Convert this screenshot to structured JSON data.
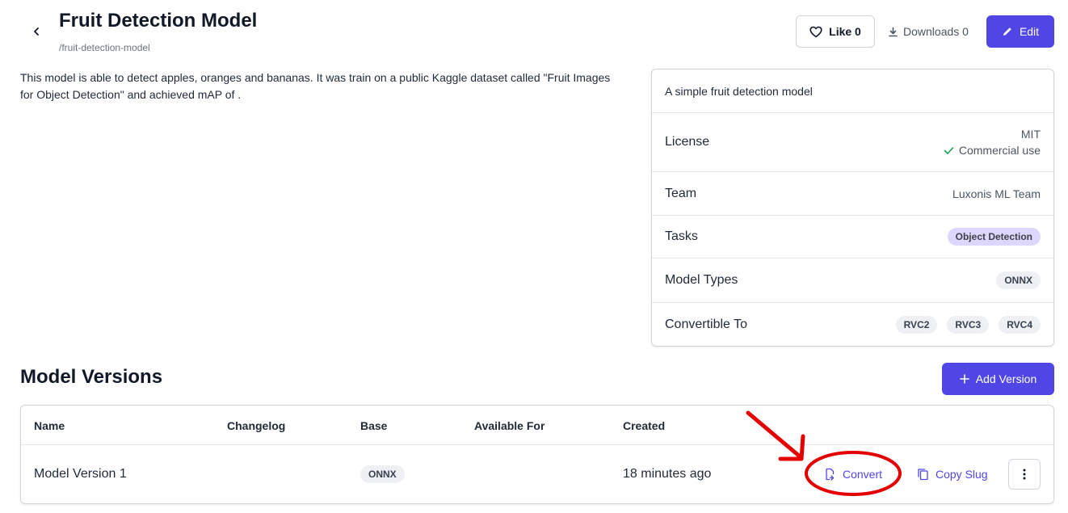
{
  "header": {
    "title": "Fruit Detection Model",
    "slug": "/fruit-detection-model",
    "like_label": "Like 0",
    "downloads_label": "Downloads 0",
    "edit_label": "Edit"
  },
  "description": "This model is able to detect apples, oranges and bananas. It was train on a public Kaggle dataset called \"Fruit Images for Object Detection\" and achieved mAP of .",
  "info": {
    "summary": "A simple fruit detection model",
    "license_label": "License",
    "license_value": "MIT",
    "license_note": "Commercial use",
    "team_label": "Team",
    "team_value": "Luxonis ML Team",
    "tasks_label": "Tasks",
    "tasks": [
      "Object Detection"
    ],
    "model_types_label": "Model Types",
    "model_types": [
      "ONNX"
    ],
    "convertible_label": "Convertible To",
    "convertible_to": [
      "RVC2",
      "RVC3",
      "RVC4"
    ]
  },
  "versions": {
    "title": "Model Versions",
    "add_label": "Add Version",
    "columns": [
      "Name",
      "Changelog",
      "Base",
      "Available For",
      "Created"
    ],
    "rows": [
      {
        "name": "Model Version 1",
        "changelog": "",
        "base": "ONNX",
        "available_for": "",
        "created": "18 minutes ago"
      }
    ],
    "convert_label": "Convert",
    "copy_slug_label": "Copy Slug"
  },
  "colors": {
    "accent": "#4f46e5",
    "success": "#16a34a",
    "annotation": "#e50000"
  },
  "icons": [
    "chevron-left-icon",
    "heart-icon",
    "download-icon",
    "pencil-icon",
    "check-icon",
    "plus-icon",
    "file-convert-icon",
    "copy-icon",
    "dots-vertical-icon"
  ]
}
